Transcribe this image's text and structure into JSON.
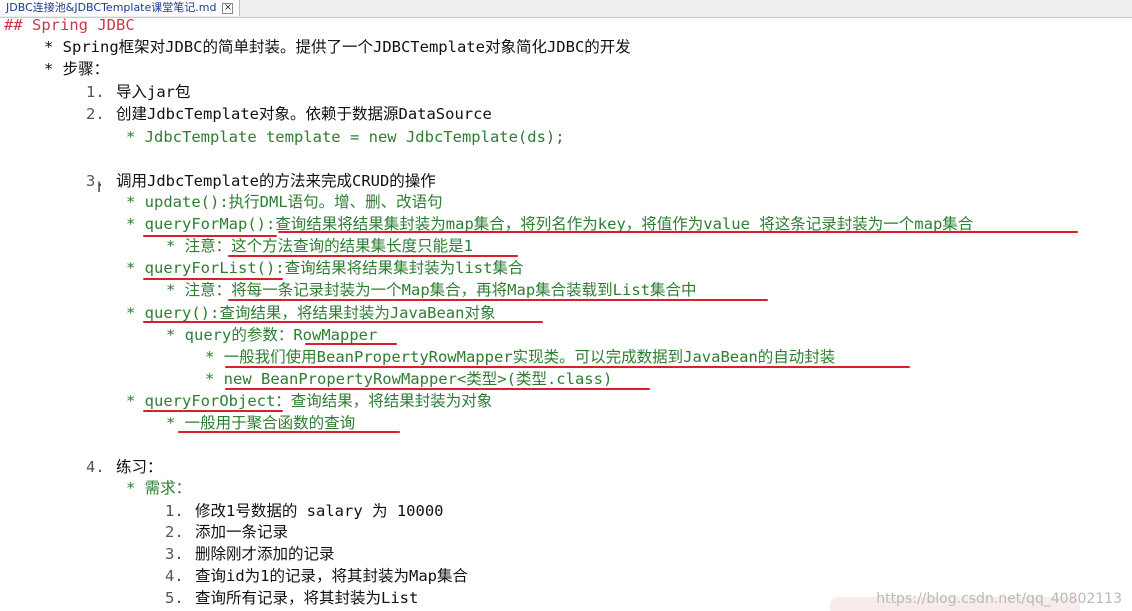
{
  "tab": {
    "title": "JDBC连接池&JDBCTemplate课堂笔记.md",
    "close": "×"
  },
  "lines": {
    "heading": "## Spring JDBC",
    "l1": "* Spring框架对JDBC的简单封装。提供了一个JDBCTemplate对象简化JDBC的开发",
    "l2": "* 步骤：",
    "s1n": "1.",
    "s1": "导入jar包",
    "s2n": "2.",
    "s2": "创建JdbcTemplate对象。依赖于数据源DataSource",
    "s2a": "* JdbcTemplate template = new JdbcTemplate(ds);",
    "s3n": "3.",
    "s3": "调用JdbcTemplate的方法来完成CRUD的操作",
    "m1": "* update():执行DML语句。增、删、改语句",
    "m2": "* queryForMap():查询结果将结果集封装为map集合，将列名作为key，将值作为value 将这条记录封装为一个map集合",
    "m2a": "* 注意：这个方法查询的结果集长度只能是1",
    "m3": "* queryForList():查询结果将结果集封装为list集合",
    "m3a": "* 注意：将每一条记录封装为一个Map集合，再将Map集合装载到List集合中",
    "m4": "* query():查询结果，将结果封装为JavaBean对象",
    "m4a": "* query的参数：RowMapper",
    "m4b": "* 一般我们使用BeanPropertyRowMapper实现类。可以完成数据到JavaBean的自动封装",
    "m4c": "* new BeanPropertyRowMapper<类型>(类型.class)",
    "m5": "* queryForObject：查询结果，将结果封装为对象",
    "m5a": "* 一般用于聚合函数的查询",
    "s4n": "4.",
    "s4": "练习：",
    "req": "* 需求：",
    "r1n": "1.",
    "r1": "修改1号数据的 salary 为 10000",
    "r2n": "2.",
    "r2": "添加一条记录",
    "r3n": "3.",
    "r3": "删除刚才添加的记录",
    "r4n": "4.",
    "r4": "查询id为1的记录，将其封装为Map集合",
    "r5n": "5.",
    "r5": "查询所有记录，将其封装为List"
  },
  "cursor_glyph": "I",
  "watermark": "https://blog.csdn.net/qq_40802113",
  "colors": {
    "heading": "#c9394a",
    "code_green": "#2e7d32",
    "underline": "#d6202b"
  }
}
